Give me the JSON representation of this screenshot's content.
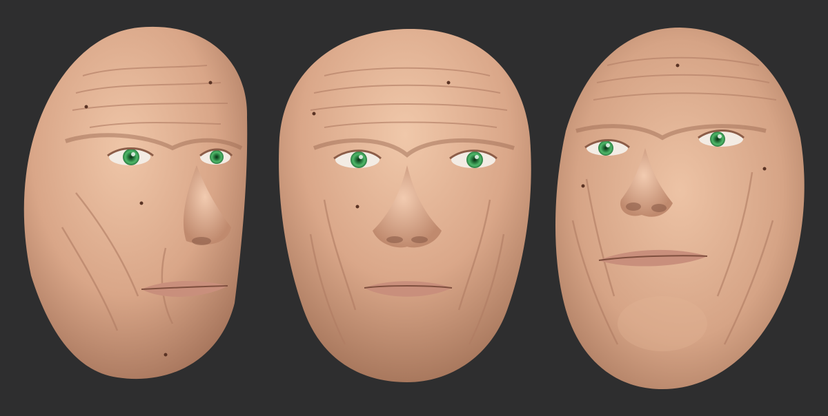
{
  "scene": {
    "background_color": "#2e2e2f",
    "skin_base": "#d8a788",
    "skin_light": "#ebc0a2",
    "skin_shadow": "#9a6a53",
    "lip_color": "#c98f7c",
    "iris_color": "#3fa35a",
    "views": [
      {
        "name": "three-quarter-left-view"
      },
      {
        "name": "front-view"
      },
      {
        "name": "low-angle-view"
      }
    ]
  }
}
